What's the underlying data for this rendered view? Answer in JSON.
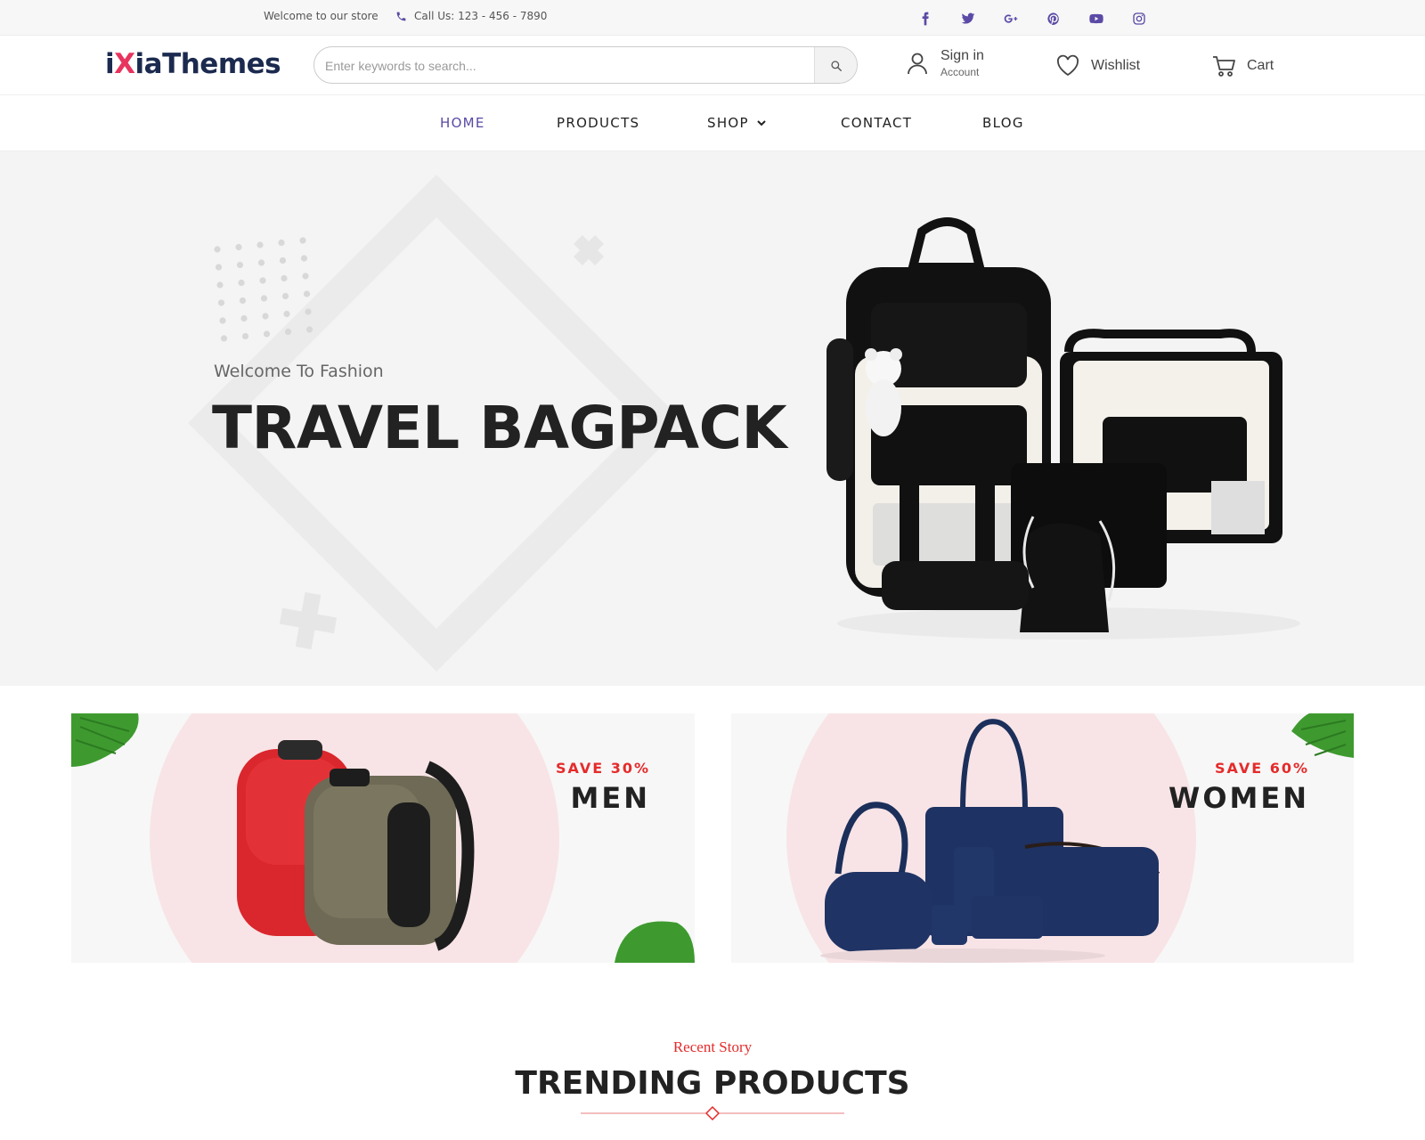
{
  "topbar": {
    "welcome": "Welcome to our store",
    "call": "Call Us: 123 - 456 - 7890",
    "social": [
      "facebook-icon",
      "twitter-icon",
      "google-plus-icon",
      "pinterest-icon",
      "youtube-icon",
      "instagram-icon"
    ],
    "accent": "#5b4aa6"
  },
  "header": {
    "logo_prefix": "i",
    "logo_x": "X",
    "logo_suffix": "iaThemes",
    "search_placeholder": "Enter keywords to search...",
    "signin_label": "Sign in",
    "signin_sub": "Account",
    "wishlist_label": "Wishlist",
    "cart_label": "Cart"
  },
  "nav": {
    "items": [
      {
        "label": "HOME",
        "active": true
      },
      {
        "label": "PRODUCTS"
      },
      {
        "label": "SHOP"
      },
      {
        "label": "CONTACT"
      },
      {
        "label": "BLOG"
      }
    ]
  },
  "hero": {
    "pre": "Welcome To Fashion",
    "title": "TRAVEL BAGPACK"
  },
  "promos": {
    "men": {
      "save": "SAVE 30%",
      "label": "MEN"
    },
    "women": {
      "save": "SAVE 60%",
      "label": "WOMEN"
    }
  },
  "trending": {
    "pre": "Recent Story",
    "title": "TRENDING PRODUCTS"
  },
  "colors": {
    "accent": "#5b4aa6",
    "sale_red": "#e52b2b",
    "logo_navy": "#1b2a4e",
    "logo_pink": "#e8335e"
  }
}
